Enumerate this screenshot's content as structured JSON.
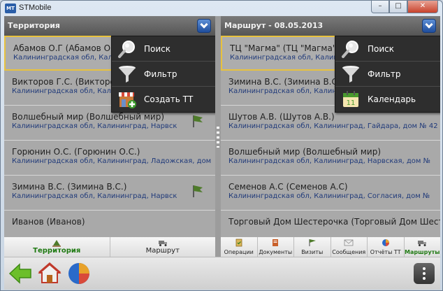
{
  "window": {
    "title": "STMobile",
    "icon_text": "MT",
    "min": "–",
    "max": "□",
    "close": "✕"
  },
  "left": {
    "header": "Территория",
    "rows": [
      {
        "name": "Абамов О.Г (Абамов О.Г)",
        "addr": "Калининградская обл, Калининград, Гайдара, дом"
      },
      {
        "name": "Викторов Г.С. (Викторов Г.С.)",
        "addr": "Калининградская обл, Калининград, Гайдара, дом"
      },
      {
        "name": "Волшебный мир (Волшебный мир)",
        "addr": "Калининградская обл, Калининград, Нарвск"
      },
      {
        "name": "Горюнин О.С. (Горюнин О.С.)",
        "addr": "Калининградская обл, Калининград, Ладожская, дом"
      },
      {
        "name": "Зимина В.С. (Зимина В.С.)",
        "addr": "Калининградская обл, Калининград, Нарвск"
      },
      {
        "name": "Иванов (Иванов)",
        "addr": ""
      }
    ],
    "menu": [
      "Поиск",
      "Фильтр",
      "Создать ТТ"
    ],
    "tabs": [
      "Территория",
      "Маршрут"
    ]
  },
  "right": {
    "header": "Маршрут - 08.05.2013",
    "rows": [
      {
        "name": "ТЦ \"Магма\" (ТЦ \"Магма\")",
        "addr": "Калининградская обл, Калининград, Гайдара, дом"
      },
      {
        "name": "Зимина В.С. (Зимина В.С.)",
        "addr": "Калининградская обл, Калининград, Нарвская, дом"
      },
      {
        "name": "Шутов А.В. (Шутов А.В.)",
        "addr": "Калининградская обл, Калининград, Гайдара, дом № 42"
      },
      {
        "name": "Волшебный мир (Волшебный мир)",
        "addr": "Калининградская обл, Калининград, Нарвская, дом №"
      },
      {
        "name": "Семенов А.С (Семенов А.С)",
        "addr": "Калининградская обл, Калининград, Согласия, дом №"
      },
      {
        "name": "Торговый Дом Шестерочка (Торговый Дом Шестерочка)",
        "addr": ""
      }
    ],
    "menu": [
      "Поиск",
      "Фильтр",
      "Календарь"
    ],
    "tabs": [
      "Операции",
      "Документы",
      "Визиты",
      "Сообщения",
      "Отчёты ТТ",
      "Маршруты"
    ]
  },
  "colors": {
    "accent_green": "#1f7a12",
    "selected_border": "#e8c23e",
    "address_blue": "#203a7a"
  }
}
